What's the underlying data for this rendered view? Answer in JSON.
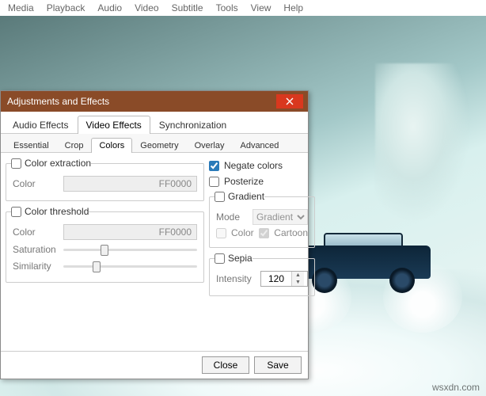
{
  "menubar": [
    "Media",
    "Playback",
    "Audio",
    "Video",
    "Subtitle",
    "Tools",
    "View",
    "Help"
  ],
  "watermark": "wsxdn.com",
  "dialog": {
    "title": "Adjustments and Effects",
    "tabs": {
      "audio": "Audio Effects",
      "video": "Video Effects",
      "sync": "Synchronization",
      "active": "video"
    },
    "subtabs": {
      "essential": "Essential",
      "crop": "Crop",
      "colors": "Colors",
      "geometry": "Geometry",
      "overlay": "Overlay",
      "advanced": "Advanced",
      "active": "colors"
    },
    "color_extraction": {
      "label": "Color extraction",
      "checked": false,
      "color_label": "Color",
      "color_value": "FF0000"
    },
    "color_threshold": {
      "label": "Color threshold",
      "checked": false,
      "color_label": "Color",
      "color_value": "FF0000",
      "saturation_label": "Saturation",
      "similarity_label": "Similarity"
    },
    "negate": {
      "label": "Negate colors",
      "checked": true
    },
    "posterize": {
      "label": "Posterize",
      "checked": false
    },
    "gradient": {
      "label": "Gradient",
      "checked": false,
      "mode_label": "Mode",
      "mode_value": "Gradient",
      "color_label": "Color",
      "color_checked": false,
      "cartoon_label": "Cartoon",
      "cartoon_checked": true
    },
    "sepia": {
      "label": "Sepia",
      "checked": false,
      "intensity_label": "Intensity",
      "intensity_value": "120"
    },
    "footer": {
      "close": "Close",
      "save": "Save"
    }
  }
}
